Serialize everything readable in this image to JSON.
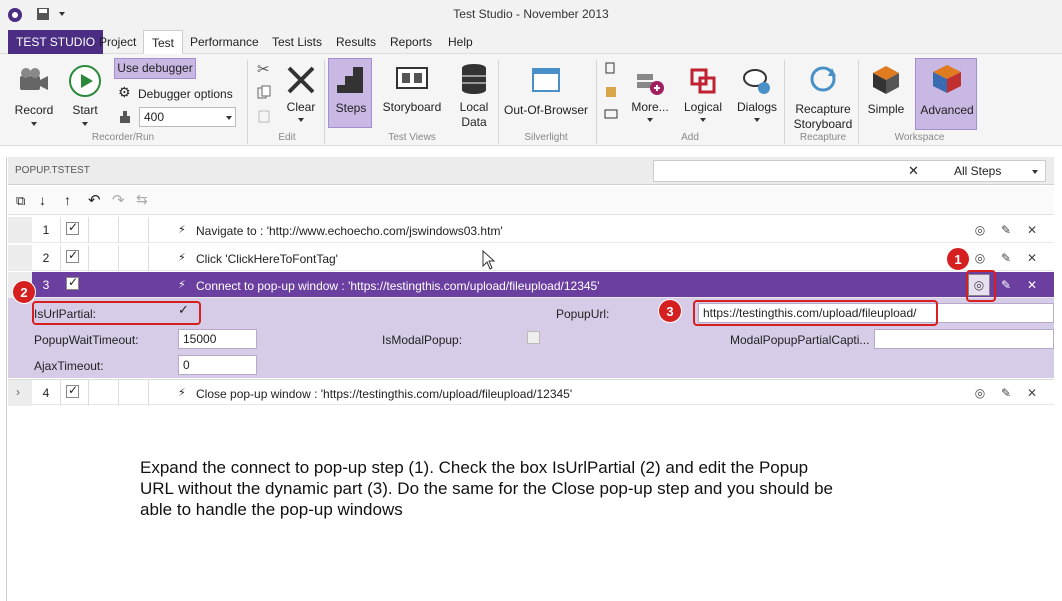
{
  "window": {
    "title": "Test Studio - November 2013"
  },
  "menu": {
    "brand": "TEST STUDIO",
    "items": [
      "Project",
      "Test",
      "Performance",
      "Test Lists",
      "Results",
      "Reports",
      "Help"
    ],
    "active": "Test"
  },
  "ribbon": {
    "record": "Record",
    "start": "Start",
    "use_debugger": "Use debugger",
    "debugger_options": "Debugger options",
    "speed_value": "400",
    "clear": "Clear",
    "steps": "Steps",
    "storyboard": "Storyboard",
    "local_data_1": "Local",
    "local_data_2": "Data",
    "out_of_browser": "Out-Of-Browser",
    "more": "More...",
    "logical": "Logical",
    "dialogs": "Dialogs",
    "recapture_1": "Recapture",
    "recapture_2": "Storyboard",
    "simple": "Simple",
    "advanced": "Advanced",
    "groups": {
      "recorder": "Recorder/Run",
      "edit": "Edit",
      "test_views": "Test Views",
      "silverlight": "Silverlight",
      "add": "Add",
      "recapture": "Recapture",
      "workspace": "Workspace"
    }
  },
  "project": {
    "file": "POPUP.TSTEST",
    "filter": "All Steps"
  },
  "steps": [
    {
      "num": "1",
      "text": "Navigate to : 'http://www.echoecho.com/jswindows03.htm'"
    },
    {
      "num": "2",
      "text": "Click 'ClickHereToFontTag'"
    },
    {
      "num": "3",
      "text": "Connect to pop-up window : 'https://testingthis.com/upload/fileupload/12345'"
    },
    {
      "num": "4",
      "text": "Close pop-up window : 'https://testingthis.com/upload/fileupload/12345'"
    }
  ],
  "details": {
    "is_url_partial_label": "IsUrlPartial:",
    "popup_url_label": "PopupUrl:",
    "popup_url_value": "https://testingthis.com/upload/fileupload/",
    "popup_wait_label": "PopupWaitTimeout:",
    "popup_wait_value": "15000",
    "is_modal_label": "IsModalPopup:",
    "modal_partial_label": "ModalPopupPartialCapti...",
    "ajax_label": "AjaxTimeout:",
    "ajax_value": "0"
  },
  "badges": [
    "1",
    "2",
    "3"
  ],
  "annotation": "Expand the connect to pop-up step (1). Check the box IsUrlPartial (2) and edit the Popup URL without the dynamic part (3). Do the same for the Close pop-up step and you should be able to handle the pop-up windows",
  "colors": {
    "brand": "#4b2e83",
    "selected_row": "#6b3fa0",
    "detail_bg": "#d7cce8",
    "highlight": "#d62020"
  }
}
